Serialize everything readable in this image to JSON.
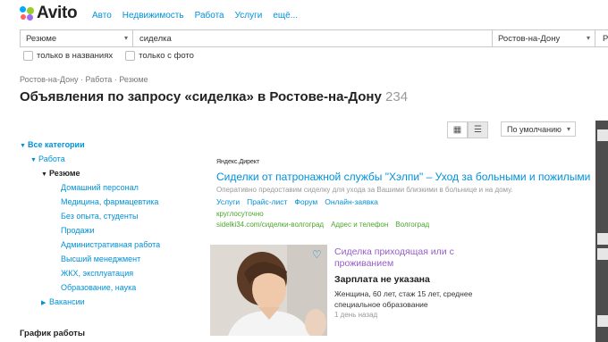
{
  "logo": {
    "text": "Avito"
  },
  "nav": [
    "Авто",
    "Недвижимость",
    "Работа",
    "Услуги",
    "ещё..."
  ],
  "search": {
    "category": "Резюме",
    "query": "сиделка",
    "city": "Ростов-на-Дону",
    "extra": "Р"
  },
  "filters": {
    "titles_only": "только в названиях",
    "with_photo": "только с фото"
  },
  "breadcrumbs": "Ростов-на-Дону · Работа · Резюме",
  "page": {
    "title": "Объявления по запросу «сиделка» в Ростове-на-Дону",
    "count": "234"
  },
  "sort": {
    "label": "По умолчанию"
  },
  "sidebar": {
    "items": [
      "Все категории",
      "Работа",
      "Резюме",
      "Домашний персонал",
      "Медицина, фармацевтика",
      "Без опыта, студенты",
      "Продажи",
      "Административная работа",
      "Высший менеджмент",
      "ЖКХ, эксплуатация",
      "Образование, наука",
      "Вакансии"
    ],
    "heading": "График работы"
  },
  "ad": {
    "label": "Яндекс.Директ",
    "title": "Сиделки от патронажной службы \"Хэлпи\" – Уход за больными и пожилыми",
    "text": "Оперативно предоставим сиделку для ухода за Вашими близкими в больнице и на дому.",
    "links": [
      "Услуги",
      "Прайс-лист",
      "Форум",
      "Онлайн-заявка"
    ],
    "tag": "круглосуточно",
    "foot": [
      "sidelki34.com/сиделки-волгоград",
      "Адрес и телефон",
      "Волгоград"
    ]
  },
  "listing": {
    "title": "Сиделка приходящая или с проживанием",
    "salary": "Зарплата не указана",
    "desc": "Женщина, 60 лет, стаж 15 лет, среднее специальное образование",
    "age": "1 день назад"
  },
  "colors": {
    "link": "#0091d9",
    "visited": "#965ec9",
    "green": "#4ca72c",
    "logo_dots": [
      "#00aaff",
      "#97cf26",
      "#ff6163",
      "#a169f7"
    ]
  }
}
